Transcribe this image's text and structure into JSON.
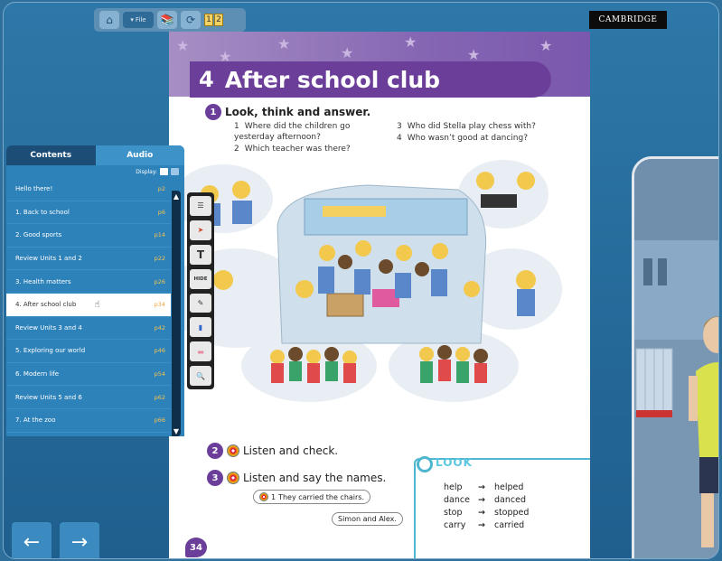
{
  "toolbar": {
    "file_label": "File",
    "pages": [
      "1",
      "2"
    ]
  },
  "brand": "CAMBRIDGE",
  "book": {
    "unit_number": "4",
    "unit_title": "After school club",
    "ex1": {
      "num": "1",
      "title": "Look, think and answer.",
      "questions": [
        {
          "n": "1",
          "text": "Where did the children go yesterday afternoon?"
        },
        {
          "n": "2",
          "text": "Which teacher was there?"
        },
        {
          "n": "3",
          "text": "Who did Stella play chess with?"
        },
        {
          "n": "4",
          "text": "Who wasn’t good at dancing?"
        }
      ]
    },
    "ex2": {
      "num": "2",
      "title": "Listen and check."
    },
    "ex3": {
      "num": "3",
      "title": "Listen and say the names.",
      "bubble1_num": "1",
      "bubble1": "They carried the chairs.",
      "bubble2": "Simon and Alex."
    },
    "look": {
      "label": "LOOK",
      "rows": [
        {
          "base": "help",
          "arrow": "→",
          "past": "helped"
        },
        {
          "base": "dance",
          "arrow": "→",
          "past": "danced"
        },
        {
          "base": "stop",
          "arrow": "→",
          "past": "stopped"
        },
        {
          "base": "carry",
          "arrow": "→",
          "past": "carried"
        }
      ]
    },
    "page_number": "34"
  },
  "contents_panel": {
    "tab_contents": "Contents",
    "tab_audio": "Audio",
    "display_label": "Display:",
    "items": [
      {
        "label": "Hello there!",
        "page": "p2"
      },
      {
        "label": "1. Back to school",
        "page": "p6"
      },
      {
        "label": "2. Good sports",
        "page": "p14"
      },
      {
        "label": "Review Units 1 and 2",
        "page": "p22"
      },
      {
        "label": "3. Health matters",
        "page": "p26"
      },
      {
        "label": "4. After school club",
        "page": "p34"
      },
      {
        "label": "Review Units 3 and 4",
        "page": "p42"
      },
      {
        "label": "5. Exploring our world",
        "page": "p46"
      },
      {
        "label": "6. Modern life",
        "page": "p54"
      },
      {
        "label": "Review Units 5 and 6",
        "page": "p62"
      },
      {
        "label": "7. At the zoo",
        "page": "p66"
      }
    ],
    "active_index": 5
  },
  "tools": {
    "hide_label": "HIDE"
  },
  "nav": {
    "prev": "←",
    "next": "→"
  }
}
